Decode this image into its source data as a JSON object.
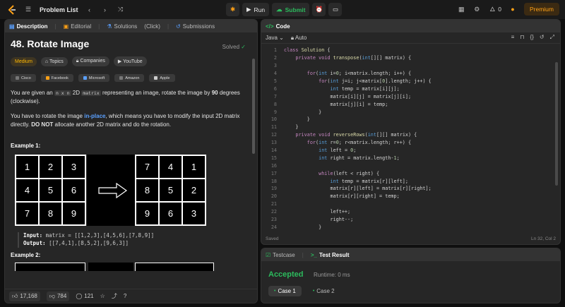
{
  "topbar": {
    "title": "Problem List",
    "run_label": "Run",
    "submit_label": "Submit",
    "streak": "0",
    "premium_label": "Premium"
  },
  "left_tabs": [
    {
      "label": "Description",
      "icon": "description-icon"
    },
    {
      "label": "Editorial",
      "icon": "editorial-icon"
    },
    {
      "label": "Solutions",
      "icon": "solutions-icon"
    },
    {
      "label": "(Click)",
      "icon": ""
    },
    {
      "label": "Submissions",
      "icon": "submissions-icon"
    }
  ],
  "problem": {
    "title": "48. Rotate Image",
    "solved_label": "Solved",
    "difficulty": "Medium",
    "chips": [
      "Topics",
      "Companies",
      "YouTube"
    ],
    "companies": [
      "Cisco",
      "Facebook",
      "Microsoft",
      "Amazon",
      "Apple"
    ],
    "p1": {
      "a": "You are given an ",
      "code": "n x n",
      "b": " 2D ",
      "code2": "matrix",
      "c": " representing an image, rotate the image by ",
      "bold": "90",
      "d": " degrees (clockwise)."
    },
    "p2": {
      "a": "You have to rotate the image ",
      "link": "in-place",
      "b": ", which means you have to modify the input 2D matrix directly. ",
      "bold": "DO NOT",
      "c": " allocate another 2D matrix and do the rotation."
    },
    "example1_title": "Example 1:",
    "matrix_in": [
      "1",
      "2",
      "3",
      "4",
      "5",
      "6",
      "7",
      "8",
      "9"
    ],
    "matrix_out": [
      "7",
      "4",
      "1",
      "8",
      "5",
      "2",
      "9",
      "6",
      "3"
    ],
    "input_label": "Input:",
    "input_value": "matrix = [[1,2,3],[4,5,6],[7,8,9]]",
    "output_label": "Output:",
    "output_value": "[[7,4,1],[8,5,2],[9,6,3]]",
    "example2_title": "Example 2:"
  },
  "bottom": {
    "likes": "17,168",
    "dislikes": "784",
    "comments": "121"
  },
  "code": {
    "title": "Code",
    "language": "Java",
    "mode": "Auto",
    "status": "Saved",
    "position": "Ln 32, Col 2",
    "lines": [
      "class Solution {",
      "    private void transpose(int[][] matrix) {",
      "",
      "        for(int i=0; i<matrix.length; i++) {",
      "            for(int j=i; j<matrix[0].length; j++) {",
      "                int temp = matrix[i][j];",
      "                matrix[i][j] = matrix[j][i];",
      "                matrix[j][i] = temp;",
      "            }",
      "        }",
      "    }",
      "    private void reverseRows(int[][] matrix) {",
      "        for(int r=0; r<matrix.length; r++) {",
      "            int left = 0;",
      "            int right = matrix.length-1;",
      "",
      "            while(left < right) {",
      "                int temp = matrix[r][left];",
      "                matrix[r][left] = matrix[r][right];",
      "                matrix[r][right] = temp;",
      "",
      "                left++;",
      "                right--;",
      "            }"
    ]
  },
  "test": {
    "tab1": "Testcase",
    "tab2": "Test Result",
    "result": "Accepted",
    "runtime": "Runtime: 0 ms",
    "cases": [
      "Case 1",
      "Case 2"
    ]
  },
  "colors": {
    "accent": "#ffa116",
    "success": "#2cbb5d",
    "medium": "#ffb800",
    "link": "#5aa0ff"
  }
}
